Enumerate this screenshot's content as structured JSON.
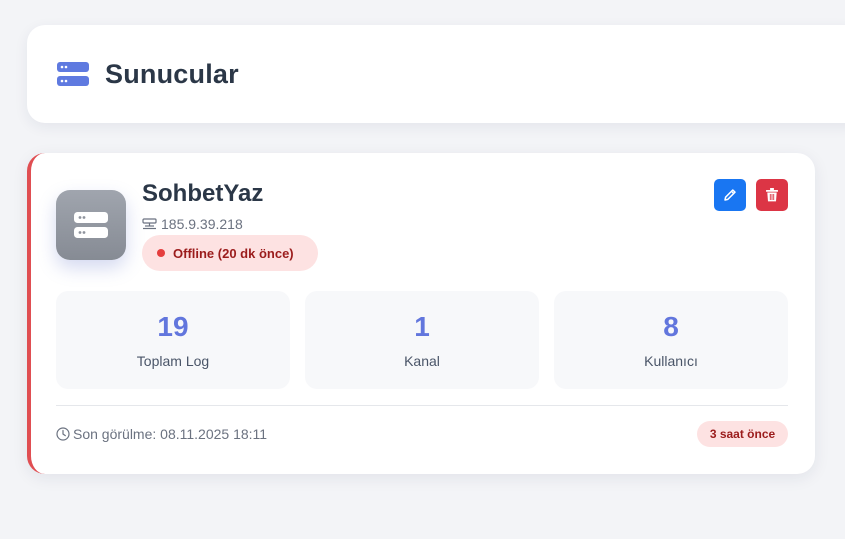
{
  "header": {
    "title": "Sunucular",
    "icon": "server-icon",
    "icon_color": "#5f7ae0"
  },
  "server": {
    "name": "SohbetYaz",
    "ip": "185.9.39.218",
    "ip_icon": "network-icon",
    "avatar_icon": "server-icon",
    "status_text": "Offline (20 dk önce)",
    "status_color": "#e53e3e",
    "accent_color": "#e04e52",
    "actions": {
      "edit_icon": "pencil-icon",
      "edit_color": "#1976f2",
      "delete_icon": "trash-icon",
      "delete_color": "#dc3545"
    },
    "stats": [
      {
        "value": "19",
        "label": "Toplam Log"
      },
      {
        "value": "1",
        "label": "Kanal"
      },
      {
        "value": "8",
        "label": "Kullanıcı"
      }
    ],
    "last_seen": "Son görülme: 08.11.2025 18:11",
    "last_seen_icon": "clock-icon",
    "ago_badge": "3 saat önce"
  }
}
